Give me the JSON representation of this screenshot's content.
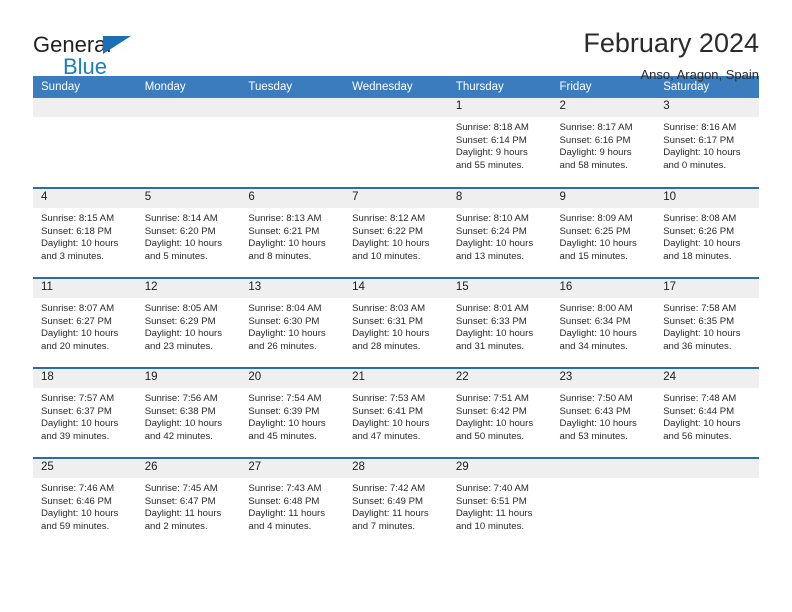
{
  "logo": {
    "word_one": "General",
    "word_two": "Blue",
    "triangle_color": "#1a6fb5",
    "blue_color": "#1a7fc1"
  },
  "header": {
    "title": "February 2024",
    "subtitle": "Anso, Aragon, Spain"
  },
  "theme": {
    "header_bg": "#3a7cbe",
    "row_divider": "#2b6cab",
    "daynum_band": "#efefef"
  },
  "calendar": {
    "weekday_headers": [
      "Sunday",
      "Monday",
      "Tuesday",
      "Wednesday",
      "Thursday",
      "Friday",
      "Saturday"
    ],
    "weeks": [
      [
        {
          "day": "",
          "empty": true
        },
        {
          "day": "",
          "empty": true
        },
        {
          "day": "",
          "empty": true
        },
        {
          "day": "",
          "empty": true
        },
        {
          "day": "1",
          "sunrise": "Sunrise: 8:18 AM",
          "sunset": "Sunset: 6:14 PM",
          "daylight_1": "Daylight: 9 hours",
          "daylight_2": "and 55 minutes."
        },
        {
          "day": "2",
          "sunrise": "Sunrise: 8:17 AM",
          "sunset": "Sunset: 6:16 PM",
          "daylight_1": "Daylight: 9 hours",
          "daylight_2": "and 58 minutes."
        },
        {
          "day": "3",
          "sunrise": "Sunrise: 8:16 AM",
          "sunset": "Sunset: 6:17 PM",
          "daylight_1": "Daylight: 10 hours",
          "daylight_2": "and 0 minutes."
        }
      ],
      [
        {
          "day": "4",
          "sunrise": "Sunrise: 8:15 AM",
          "sunset": "Sunset: 6:18 PM",
          "daylight_1": "Daylight: 10 hours",
          "daylight_2": "and 3 minutes."
        },
        {
          "day": "5",
          "sunrise": "Sunrise: 8:14 AM",
          "sunset": "Sunset: 6:20 PM",
          "daylight_1": "Daylight: 10 hours",
          "daylight_2": "and 5 minutes."
        },
        {
          "day": "6",
          "sunrise": "Sunrise: 8:13 AM",
          "sunset": "Sunset: 6:21 PM",
          "daylight_1": "Daylight: 10 hours",
          "daylight_2": "and 8 minutes."
        },
        {
          "day": "7",
          "sunrise": "Sunrise: 8:12 AM",
          "sunset": "Sunset: 6:22 PM",
          "daylight_1": "Daylight: 10 hours",
          "daylight_2": "and 10 minutes."
        },
        {
          "day": "8",
          "sunrise": "Sunrise: 8:10 AM",
          "sunset": "Sunset: 6:24 PM",
          "daylight_1": "Daylight: 10 hours",
          "daylight_2": "and 13 minutes."
        },
        {
          "day": "9",
          "sunrise": "Sunrise: 8:09 AM",
          "sunset": "Sunset: 6:25 PM",
          "daylight_1": "Daylight: 10 hours",
          "daylight_2": "and 15 minutes."
        },
        {
          "day": "10",
          "sunrise": "Sunrise: 8:08 AM",
          "sunset": "Sunset: 6:26 PM",
          "daylight_1": "Daylight: 10 hours",
          "daylight_2": "and 18 minutes."
        }
      ],
      [
        {
          "day": "11",
          "sunrise": "Sunrise: 8:07 AM",
          "sunset": "Sunset: 6:27 PM",
          "daylight_1": "Daylight: 10 hours",
          "daylight_2": "and 20 minutes."
        },
        {
          "day": "12",
          "sunrise": "Sunrise: 8:05 AM",
          "sunset": "Sunset: 6:29 PM",
          "daylight_1": "Daylight: 10 hours",
          "daylight_2": "and 23 minutes."
        },
        {
          "day": "13",
          "sunrise": "Sunrise: 8:04 AM",
          "sunset": "Sunset: 6:30 PM",
          "daylight_1": "Daylight: 10 hours",
          "daylight_2": "and 26 minutes."
        },
        {
          "day": "14",
          "sunrise": "Sunrise: 8:03 AM",
          "sunset": "Sunset: 6:31 PM",
          "daylight_1": "Daylight: 10 hours",
          "daylight_2": "and 28 minutes."
        },
        {
          "day": "15",
          "sunrise": "Sunrise: 8:01 AM",
          "sunset": "Sunset: 6:33 PM",
          "daylight_1": "Daylight: 10 hours",
          "daylight_2": "and 31 minutes."
        },
        {
          "day": "16",
          "sunrise": "Sunrise: 8:00 AM",
          "sunset": "Sunset: 6:34 PM",
          "daylight_1": "Daylight: 10 hours",
          "daylight_2": "and 34 minutes."
        },
        {
          "day": "17",
          "sunrise": "Sunrise: 7:58 AM",
          "sunset": "Sunset: 6:35 PM",
          "daylight_1": "Daylight: 10 hours",
          "daylight_2": "and 36 minutes."
        }
      ],
      [
        {
          "day": "18",
          "sunrise": "Sunrise: 7:57 AM",
          "sunset": "Sunset: 6:37 PM",
          "daylight_1": "Daylight: 10 hours",
          "daylight_2": "and 39 minutes."
        },
        {
          "day": "19",
          "sunrise": "Sunrise: 7:56 AM",
          "sunset": "Sunset: 6:38 PM",
          "daylight_1": "Daylight: 10 hours",
          "daylight_2": "and 42 minutes."
        },
        {
          "day": "20",
          "sunrise": "Sunrise: 7:54 AM",
          "sunset": "Sunset: 6:39 PM",
          "daylight_1": "Daylight: 10 hours",
          "daylight_2": "and 45 minutes."
        },
        {
          "day": "21",
          "sunrise": "Sunrise: 7:53 AM",
          "sunset": "Sunset: 6:41 PM",
          "daylight_1": "Daylight: 10 hours",
          "daylight_2": "and 47 minutes."
        },
        {
          "day": "22",
          "sunrise": "Sunrise: 7:51 AM",
          "sunset": "Sunset: 6:42 PM",
          "daylight_1": "Daylight: 10 hours",
          "daylight_2": "and 50 minutes."
        },
        {
          "day": "23",
          "sunrise": "Sunrise: 7:50 AM",
          "sunset": "Sunset: 6:43 PM",
          "daylight_1": "Daylight: 10 hours",
          "daylight_2": "and 53 minutes."
        },
        {
          "day": "24",
          "sunrise": "Sunrise: 7:48 AM",
          "sunset": "Sunset: 6:44 PM",
          "daylight_1": "Daylight: 10 hours",
          "daylight_2": "and 56 minutes."
        }
      ],
      [
        {
          "day": "25",
          "sunrise": "Sunrise: 7:46 AM",
          "sunset": "Sunset: 6:46 PM",
          "daylight_1": "Daylight: 10 hours",
          "daylight_2": "and 59 minutes."
        },
        {
          "day": "26",
          "sunrise": "Sunrise: 7:45 AM",
          "sunset": "Sunset: 6:47 PM",
          "daylight_1": "Daylight: 11 hours",
          "daylight_2": "and 2 minutes."
        },
        {
          "day": "27",
          "sunrise": "Sunrise: 7:43 AM",
          "sunset": "Sunset: 6:48 PM",
          "daylight_1": "Daylight: 11 hours",
          "daylight_2": "and 4 minutes."
        },
        {
          "day": "28",
          "sunrise": "Sunrise: 7:42 AM",
          "sunset": "Sunset: 6:49 PM",
          "daylight_1": "Daylight: 11 hours",
          "daylight_2": "and 7 minutes."
        },
        {
          "day": "29",
          "sunrise": "Sunrise: 7:40 AM",
          "sunset": "Sunset: 6:51 PM",
          "daylight_1": "Daylight: 11 hours",
          "daylight_2": "and 10 minutes."
        },
        {
          "day": "",
          "empty": true
        },
        {
          "day": "",
          "empty": true
        }
      ]
    ]
  }
}
